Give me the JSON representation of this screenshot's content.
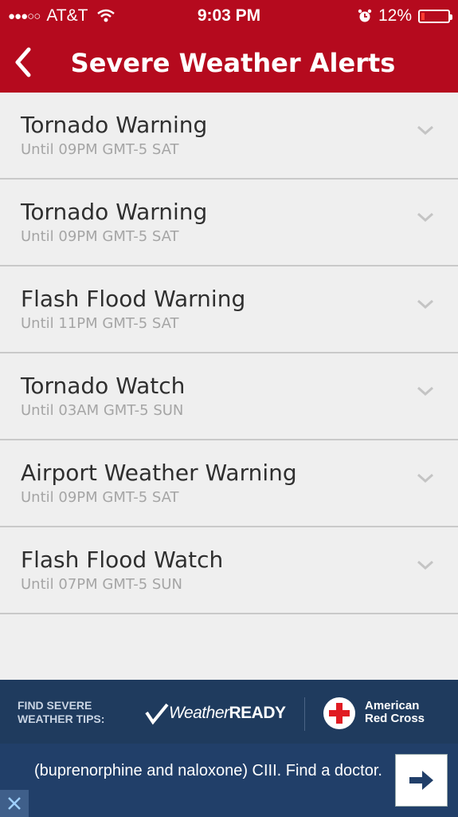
{
  "status_bar": {
    "signal": "●●●○○",
    "carrier": "AT&T",
    "time": "9:03 PM",
    "battery": "12%",
    "battery_level": 0.12
  },
  "header": {
    "title": "Severe Weather Alerts",
    "back_icon": "chevron-left-icon"
  },
  "alerts": [
    {
      "title": "Tornado Warning",
      "until": "Until 09PM GMT-5 SAT"
    },
    {
      "title": "Tornado Warning",
      "until": "Until 09PM GMT-5 SAT"
    },
    {
      "title": "Flash Flood Warning",
      "until": "Until 11PM GMT-5 SAT"
    },
    {
      "title": "Tornado Watch",
      "until": "Until 03AM GMT-5 SUN"
    },
    {
      "title": "Airport Weather Warning",
      "until": "Until 09PM GMT-5 SAT"
    },
    {
      "title": "Flash Flood Watch",
      "until": "Until 07PM GMT-5 SUN"
    }
  ],
  "banner": {
    "tips_line1": "FIND SEVERE",
    "tips_line2": "WEATHER TIPS:",
    "weather_ready_a": "Weather",
    "weather_ready_b": "READY",
    "red_cross_line1": "American",
    "red_cross_line2": "Red Cross"
  },
  "ad": {
    "text": "(buprenorphine and naloxone) CIII. Find a doctor."
  },
  "colors": {
    "header_red": "#b50a1e",
    "banner_navy": "#1f3b5e",
    "list_bg": "#efefef"
  }
}
